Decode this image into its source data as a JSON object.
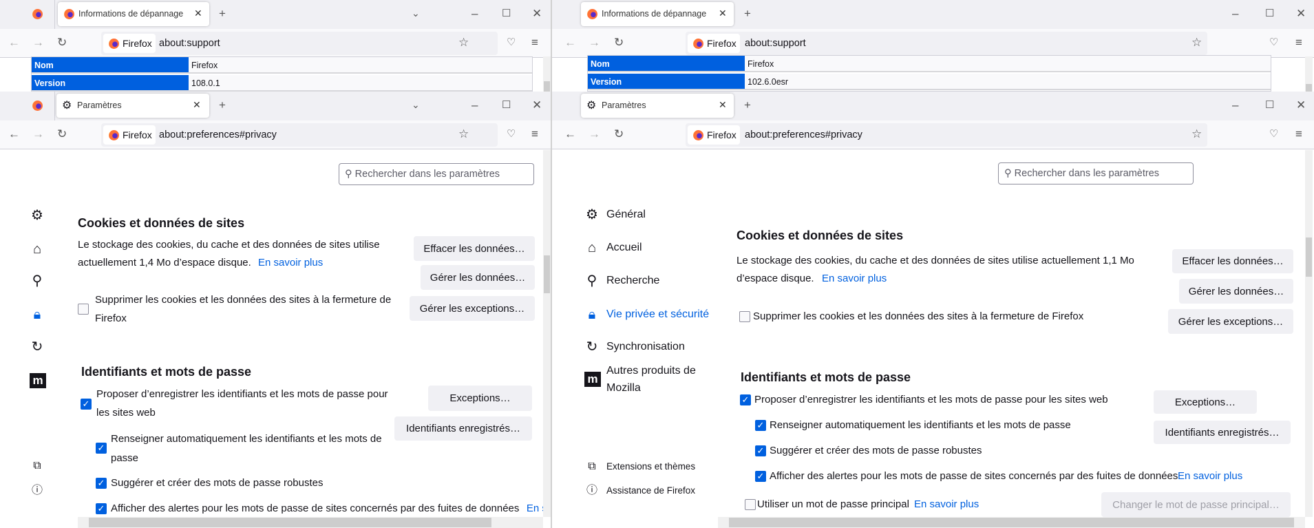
{
  "left": {
    "support": {
      "tab_title": "Informations de dépannage",
      "url_identity": "Firefox",
      "url": "about:support",
      "table": [
        {
          "label": "Nom",
          "value": "Firefox"
        },
        {
          "label": "Version",
          "value": "108.0.1"
        }
      ]
    },
    "prefs": {
      "tab_title": "Paramètres",
      "url_identity": "Firefox",
      "url": "about:preferences#privacy",
      "search_placeholder": "Rechercher dans les paramètres",
      "cookies": {
        "heading": "Cookies et données de sites",
        "desc_line1": "Le stockage des cookies, du cache et des données de sites utilise",
        "desc_line2": "actuellement 1,4 Mo d’espace disque.",
        "learn_more": "En savoir plus",
        "clear_btn": "Effacer les données…",
        "manage_btn": "Gérer les données…",
        "exceptions_btn": "Gérer les exceptions…",
        "delete_on_close_line1": "Supprimer les cookies et les données des sites à la fermeture de",
        "delete_on_close_line2": "Firefox"
      },
      "logins": {
        "heading": "Identifiants et mots de passe",
        "offer_line1": "Proposer d’enregistrer les identifiants et les mots de passe pour",
        "offer_line2": "les sites web",
        "autofill_line1": "Renseigner automatiquement les identifiants et les mots de",
        "autofill_line2": "passe",
        "suggest": "Suggérer et créer des mots de passe robustes",
        "alerts": "Afficher des alertes pour les mots de passe de sites concernés par des fuites de données",
        "alerts_learn_more": "En savoir plus",
        "exceptions_btn": "Exceptions…",
        "saved_btn": "Identifiants enregistrés…"
      }
    }
  },
  "right": {
    "support": {
      "tab_title": "Informations de dépannage",
      "url_identity": "Firefox",
      "url": "about:support",
      "table": [
        {
          "label": "Nom",
          "value": "Firefox"
        },
        {
          "label": "Version",
          "value": "102.6.0esr"
        }
      ]
    },
    "prefs": {
      "tab_title": "Paramètres",
      "url_identity": "Firefox",
      "url": "about:preferences#privacy",
      "search_placeholder": "Rechercher dans les paramètres",
      "sidebar": {
        "general": "Général",
        "home": "Accueil",
        "search": "Recherche",
        "privacy": "Vie privée et sécurité",
        "sync": "Synchronisation",
        "mozilla_line1": "Autres produits de",
        "mozilla_line2": "Mozilla",
        "extensions": "Extensions et thèmes",
        "support": "Assistance de Firefox"
      },
      "cookies": {
        "heading": "Cookies et données de sites",
        "desc_line1": "Le stockage des cookies, du cache et des données de sites utilise actuellement 1,1 Mo",
        "desc_line2": "d’espace disque.",
        "learn_more": "En savoir plus",
        "clear_btn": "Effacer les données…",
        "manage_btn": "Gérer les données…",
        "exceptions_btn": "Gérer les exceptions…",
        "delete_on_close": "Supprimer les cookies et les données des sites à la fermeture de Firefox"
      },
      "logins": {
        "heading": "Identifiants et mots de passe",
        "offer": "Proposer d’enregistrer les identifiants et les mots de passe pour les sites web",
        "autofill": "Renseigner automatiquement les identifiants et les mots de passe",
        "suggest": "Suggérer et créer des mots de passe robustes",
        "alerts": "Afficher des alertes pour les mots de passe de sites concernés par des fuites de données",
        "alerts_learn_more": "En savoir plus",
        "primary_password": "Utiliser un mot de passe principal",
        "primary_learn_more": "En savoir plus",
        "exceptions_btn": "Exceptions…",
        "saved_btn": "Identifiants enregistrés…",
        "change_primary_btn": "Changer le mot de passe principal…"
      }
    }
  },
  "colors": {
    "accent": "#0060df",
    "tabbar": "#f0f0f4",
    "button": "#f0f0f4"
  }
}
